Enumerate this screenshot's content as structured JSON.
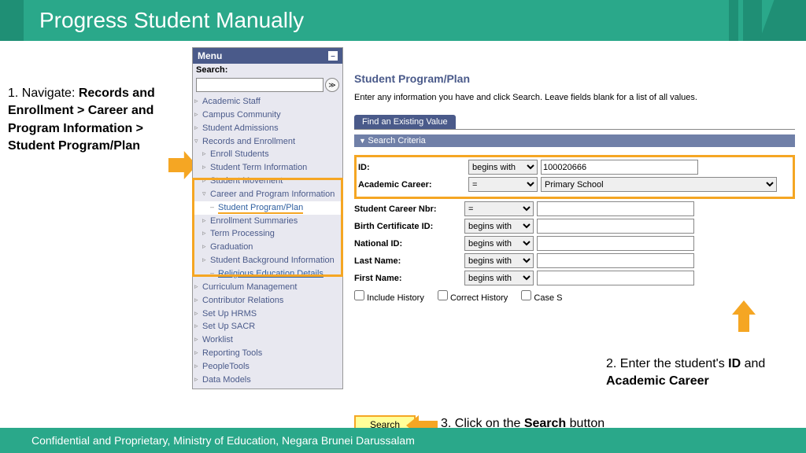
{
  "title": "Progress Student Manually",
  "step1": {
    "prefix": "1. Navigate: ",
    "bold": "Records and Enrollment > Career and Program Information > Student Program/Plan"
  },
  "step2": {
    "prefix": "2. Enter the student's ",
    "b1": "ID",
    "mid": " and ",
    "b2": "Academic Career"
  },
  "step3": {
    "prefix": "3. Click on the ",
    "bold": "Search",
    "suffix": " button"
  },
  "menu": {
    "header": "Menu",
    "search_label": "Search:",
    "items": [
      "Academic Staff",
      "Campus Community",
      "Student Admissions",
      "Records and Enrollment",
      "Enroll Students",
      "Student Term Information",
      "Student Movement",
      "Career and Program Information",
      "Student Program/Plan",
      "Enrollment Summaries",
      "Term Processing",
      "Graduation",
      "Student Background Information",
      "Religious Education Details",
      "Curriculum Management",
      "Contributor Relations",
      "Set Up HRMS",
      "Set Up SACR",
      "Worklist",
      "Reporting Tools",
      "PeopleTools",
      "Data Models"
    ]
  },
  "form": {
    "title": "Student Program/Plan",
    "instr": "Enter any information you have and click Search. Leave fields blank for a list of all values.",
    "tab": "Find an Existing Value",
    "criteria_hdr": "Search Criteria",
    "labels": {
      "id": "ID:",
      "career": "Academic Career:",
      "nbr": "Student Career Nbr:",
      "birth": "Birth Certificate ID:",
      "national": "National ID:",
      "last": "Last Name:",
      "first": "First Name:"
    },
    "ops": {
      "begins": "begins with",
      "eq": "="
    },
    "values": {
      "id": "100020666",
      "career": "Primary School"
    },
    "checks": {
      "history": "Include History",
      "correct": "Correct History",
      "case": "Case S"
    },
    "search_btn": "Search"
  },
  "footer": "Confidential and Proprietary, Ministry of Education, Negara Brunei Darussalam"
}
